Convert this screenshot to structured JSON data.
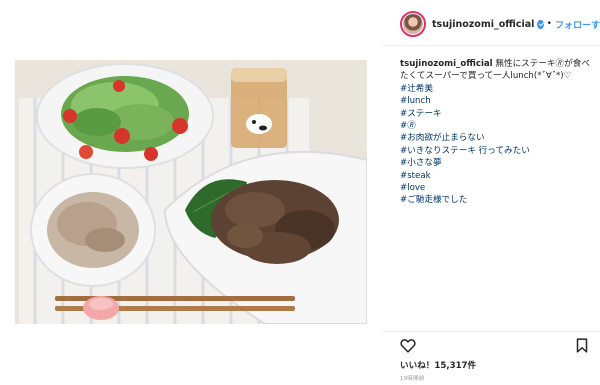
{
  "post": {
    "username": "tsujinozomi_official",
    "follow_label": "フォローす",
    "dot": "•"
  },
  "caption": {
    "username": "tsujinozomi_official",
    "text": "無性にステーキ🄬が食べたくてスーパーで買って一人lunch(*ˇ∀ˇ*)♡",
    "tags": [
      "#辻希美",
      "#lunch",
      "#ステーキ",
      "#🄬",
      "#お肉欲が止まらない",
      "#いきなりステーキ 行ってみたい",
      "#小さな夢",
      "#steak",
      "#love",
      "#ご馳走様でした"
    ]
  },
  "engagement": {
    "likes": "いいね！15,317件",
    "time": "19時間前"
  },
  "colors": {
    "accent": "#3897f0",
    "hashtag": "#003569",
    "story_ring": "#e1306c"
  },
  "icons": {
    "like": "heart-icon",
    "save": "bookmark-icon",
    "verified": "verified-badge-icon"
  }
}
